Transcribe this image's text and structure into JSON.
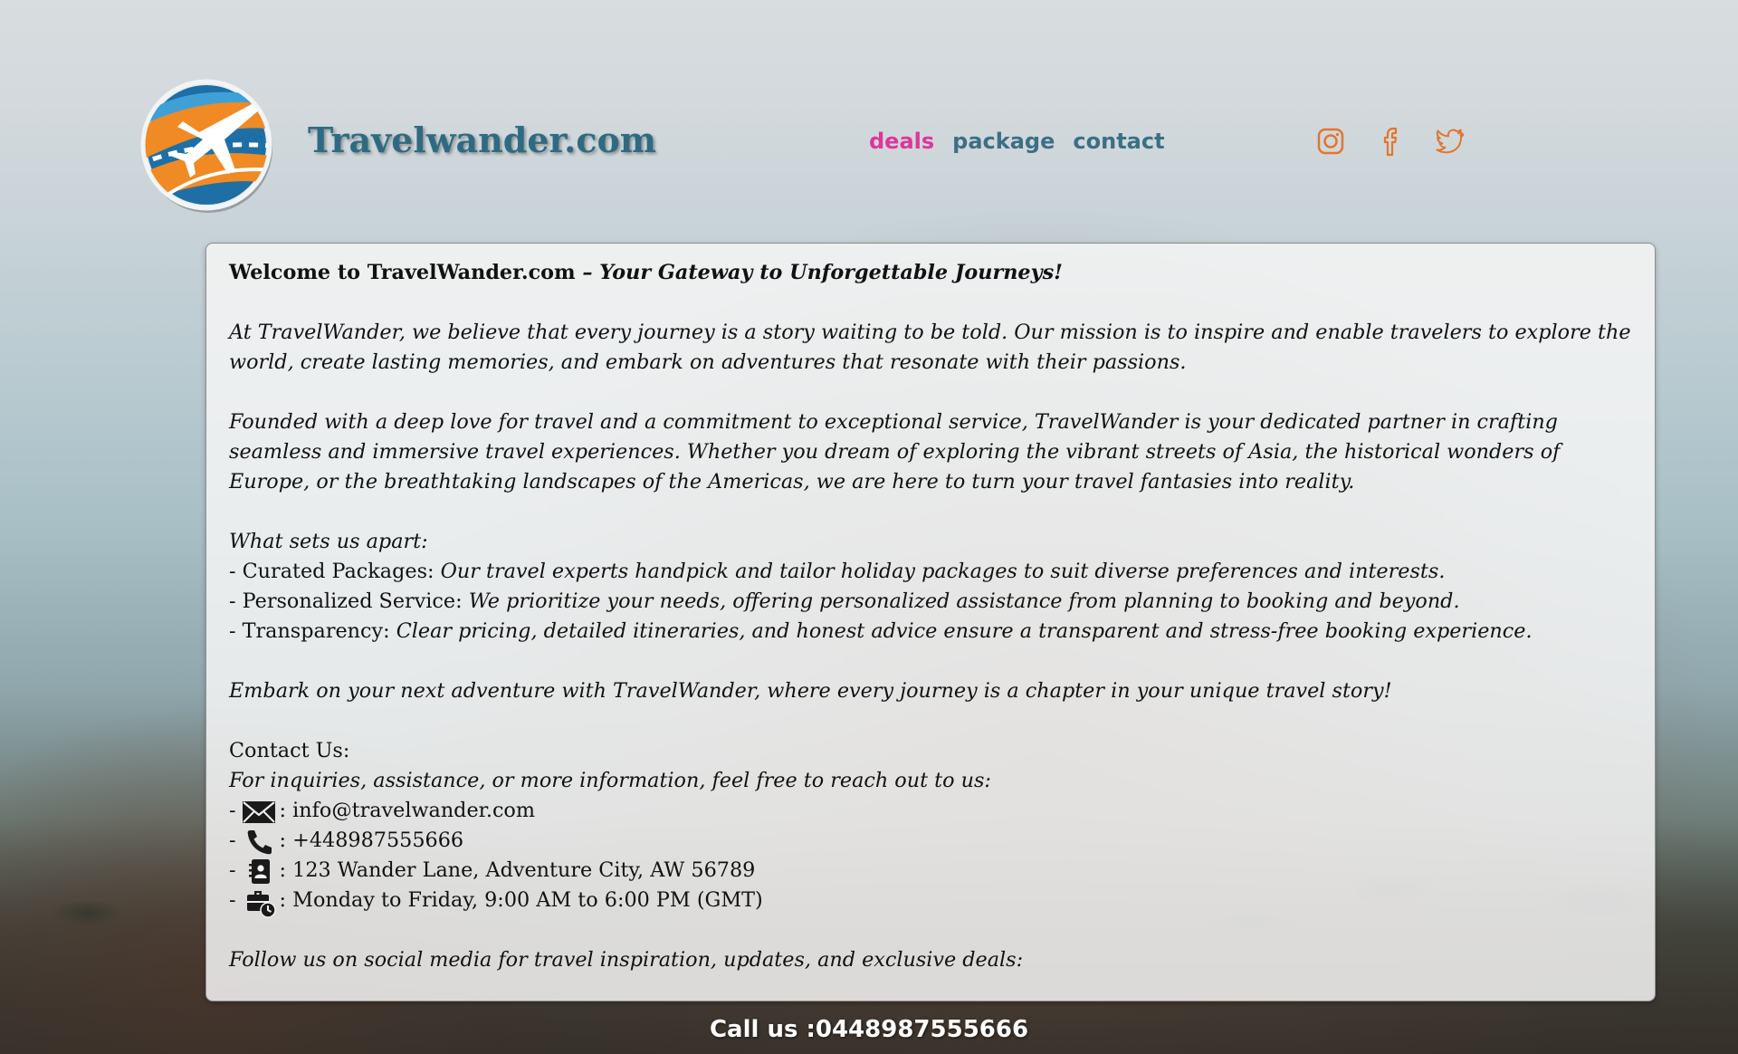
{
  "header": {
    "logo_icon": "globe-airplane-logo",
    "site_title": "Travelwander.com",
    "nav": [
      {
        "label": "deals",
        "active": true
      },
      {
        "label": "package",
        "active": false
      },
      {
        "label": "contact",
        "active": false
      }
    ],
    "social": [
      "instagram-icon",
      "facebook-icon",
      "twitter-icon"
    ],
    "colors": {
      "title": "#2e6b82",
      "nav_active": "#e0359a",
      "nav": "#3c6f86",
      "social": "#e2762f"
    }
  },
  "content": {
    "welcome_lead": "Welcome to TravelWander.com ",
    "welcome_tail": " – Your Gateway to Unforgettable Journeys!",
    "intro": "At TravelWander, we believe that every journey is a story waiting to be told. Our mission is to inspire and enable travelers to explore the world, create lasting memories, and embark on adventures that resonate with their passions.",
    "founded": "Founded with a deep love for travel and a commitment to exceptional service, TravelWander is your dedicated partner in crafting seamless and immersive travel experiences. Whether you dream of exploring the vibrant streets of Asia, the historical wonders of Europe, or the breathtaking landscapes of the Americas, we are here to turn your travel fantasies into reality.",
    "apart_heading": "What sets us apart:",
    "apart_items": [
      {
        "prefix": "- Curated Packages: ",
        "text": "Our travel experts handpick and tailor holiday packages to suit diverse preferences and interests."
      },
      {
        "prefix": "- Personalized Service: ",
        "text": "We prioritize your needs, offering personalized assistance from planning to booking and beyond."
      },
      {
        "prefix": "- Transparency: ",
        "text": "Clear pricing, detailed itineraries, and honest advice ensure a transparent and stress-free booking experience."
      }
    ],
    "embark": "Embark on your next adventure with TravelWander, where every journey is a chapter in your unique travel story!",
    "contact_heading": "Contact Us:",
    "contact_intro": "For inquiries, assistance, or more information, feel free to reach out to us:",
    "contact_items": [
      {
        "icon": "envelope-icon",
        "text": ": info@travelwander.com"
      },
      {
        "icon": "phone-icon",
        "text": ": +448987555666"
      },
      {
        "icon": "address-book-icon",
        "text": ": 123 Wander Lane, Adventure City, AW 56789"
      },
      {
        "icon": "business-hours-icon",
        "text": ":  Monday to Friday, 9:00 AM to 6:00 PM (GMT)"
      }
    ],
    "follow": "Follow us on social media for travel inspiration, updates, and exclusive deals:"
  },
  "footer": {
    "call": "Call us :0448987555666"
  }
}
